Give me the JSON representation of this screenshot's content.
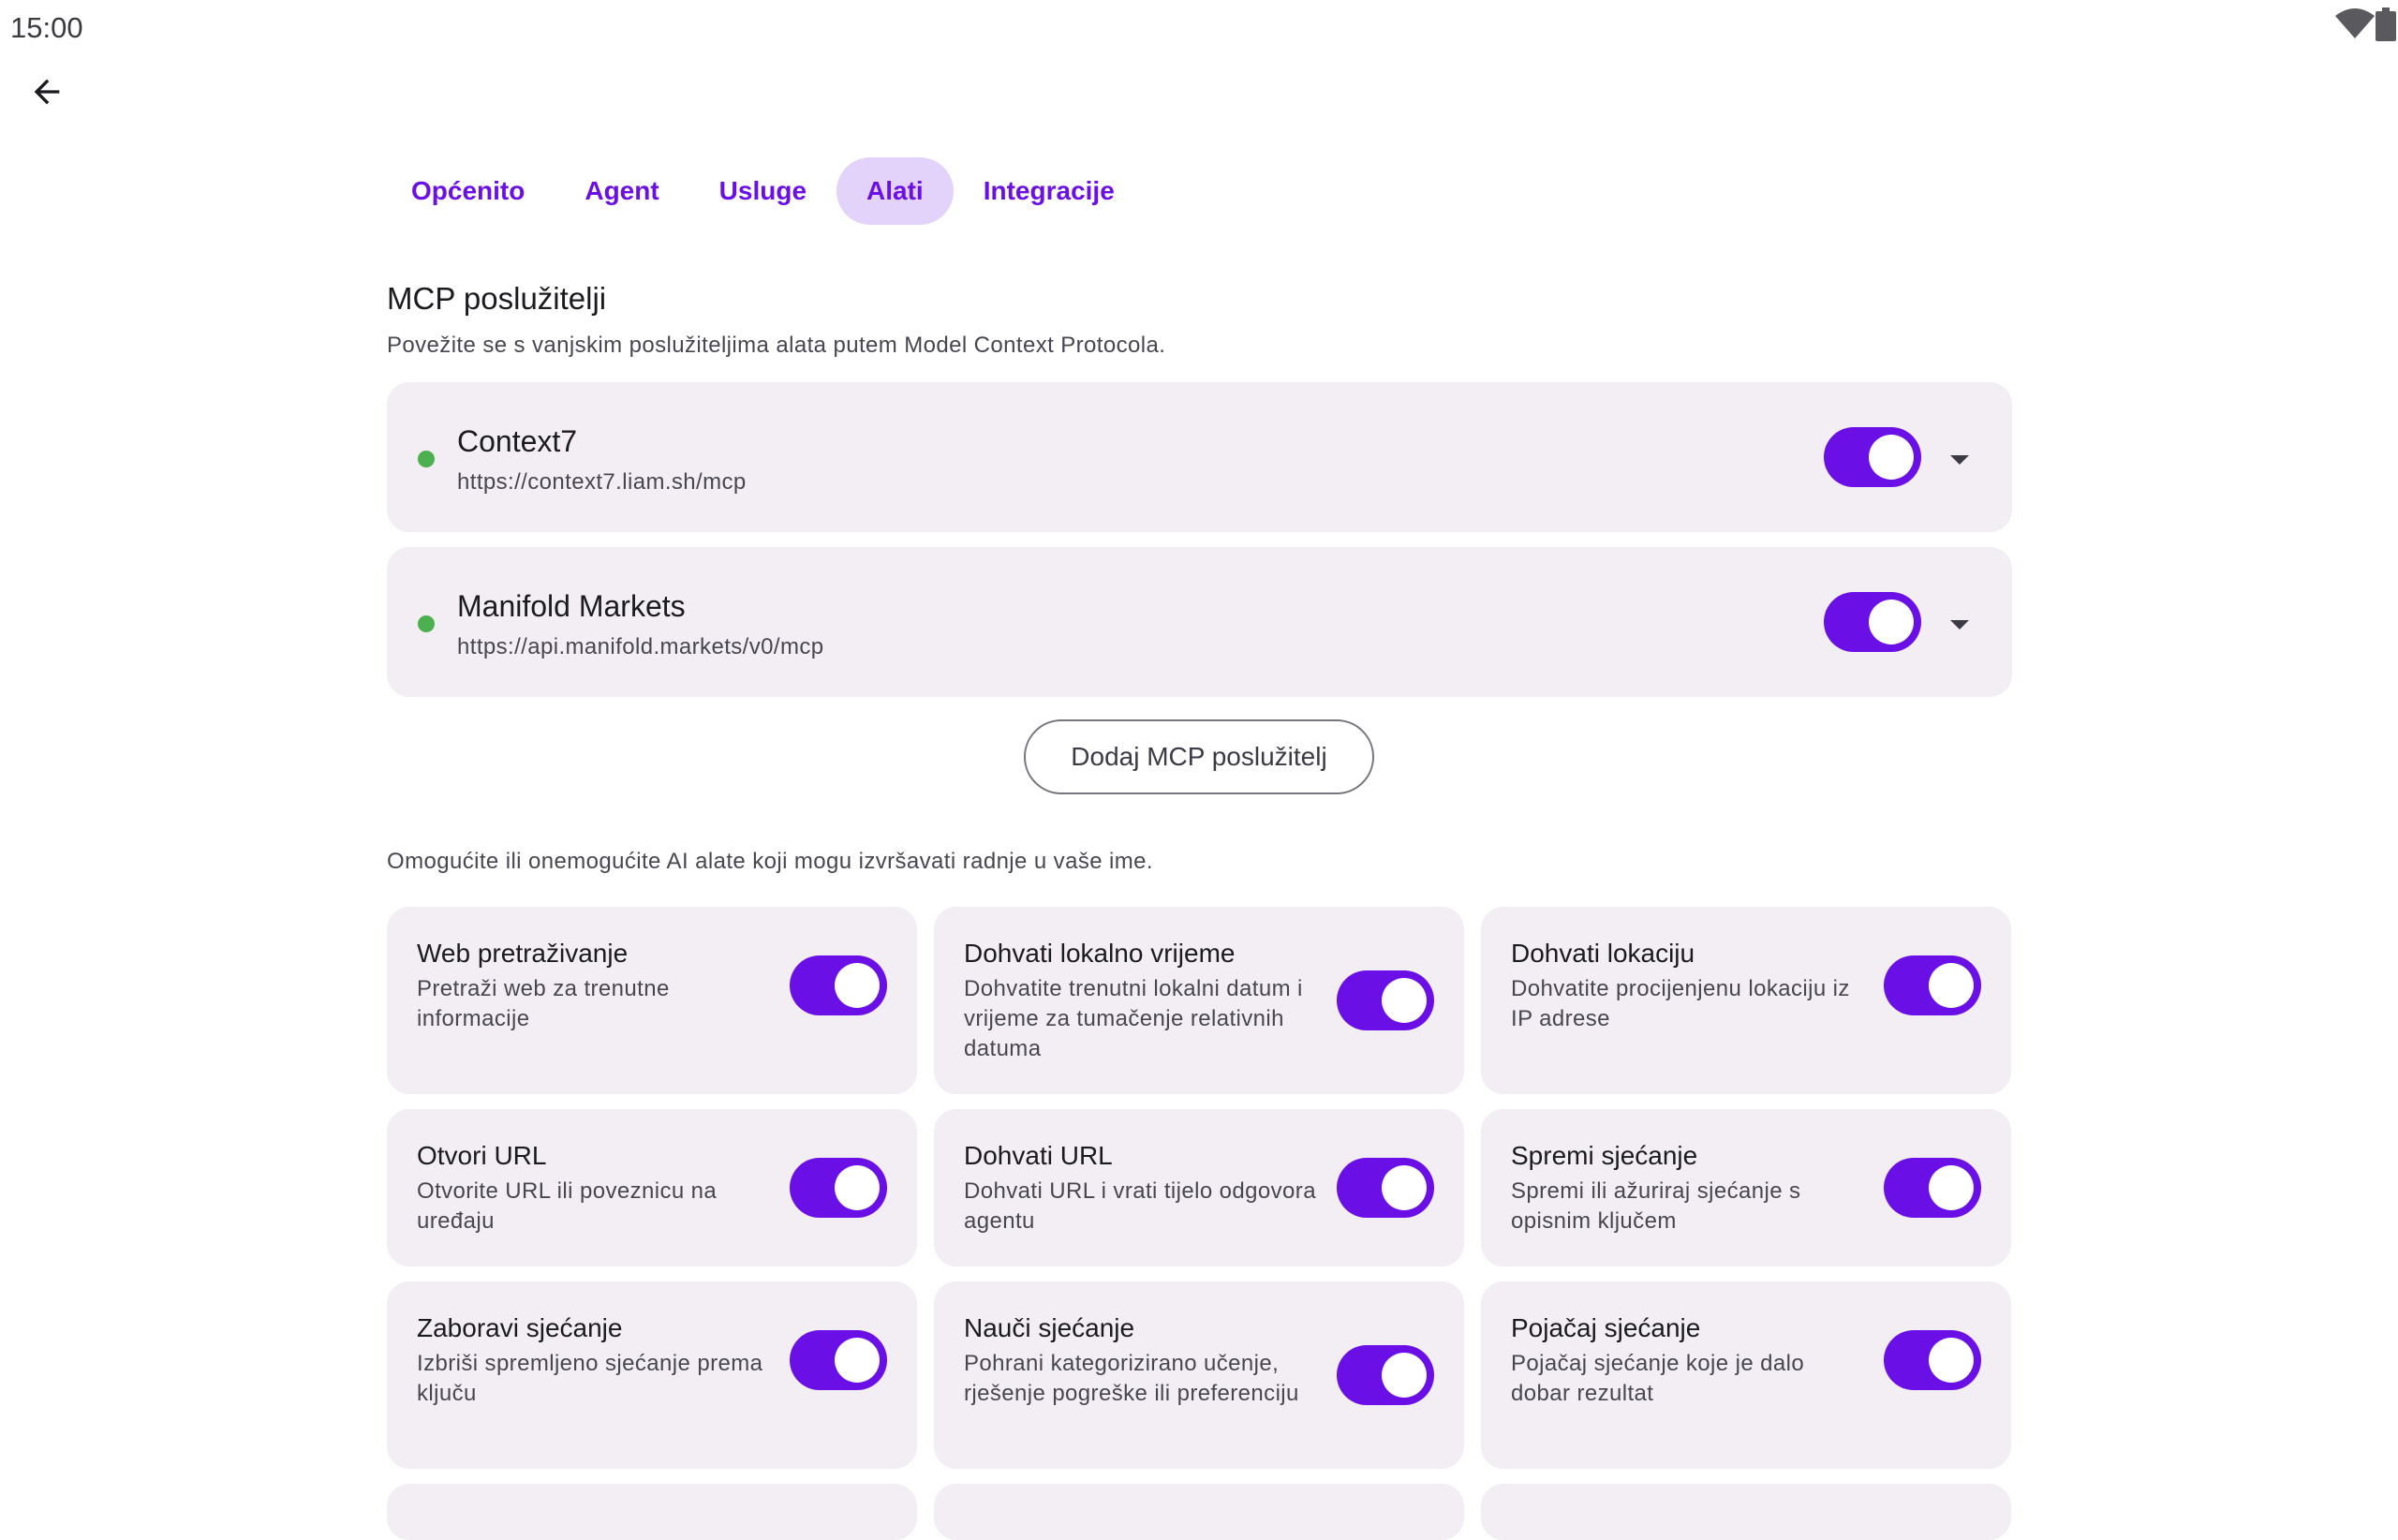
{
  "status_bar": {
    "time": "15:00",
    "wifi_icon": "wifi-icon",
    "battery_icon": "battery-icon"
  },
  "back_icon": "arrow-back-icon",
  "tabs": [
    {
      "label": "Općenito",
      "active": false
    },
    {
      "label": "Agent",
      "active": false
    },
    {
      "label": "Usluge",
      "active": false
    },
    {
      "label": "Alati",
      "active": true
    },
    {
      "label": "Integracije",
      "active": false
    }
  ],
  "mcp": {
    "title": "MCP poslužitelji",
    "description": "Povežite se s vanjskim poslužiteljima alata putem Model Context Protocola.",
    "servers": [
      {
        "name": "Context7",
        "url": "https://context7.liam.sh/mcp",
        "status": "connected",
        "enabled": true
      },
      {
        "name": "Manifold Markets",
        "url": "https://api.manifold.markets/v0/mcp",
        "status": "connected",
        "enabled": true
      }
    ],
    "add_button": "Dodaj MCP poslužitelj"
  },
  "tools": {
    "description": "Omogućite ili onemogućite AI alate koji mogu izvršavati radnje u vaše ime.",
    "items": [
      {
        "title": "Web pretraživanje",
        "description": "Pretraži web za trenutne informacije",
        "enabled": true
      },
      {
        "title": "Dohvati lokalno vrijeme",
        "description": "Dohvatite trenutni lokalni datum i vrijeme za tumačenje relativnih datuma",
        "enabled": true
      },
      {
        "title": "Dohvati lokaciju",
        "description": "Dohvatite procijenjenu lokaciju iz IP adrese",
        "enabled": true
      },
      {
        "title": "Otvori URL",
        "description": "Otvorite URL ili poveznicu na uređaju",
        "enabled": true
      },
      {
        "title": "Dohvati URL",
        "description": "Dohvati URL i vrati tijelo odgovora agentu",
        "enabled": true
      },
      {
        "title": "Spremi sjećanje",
        "description": "Spremi ili ažuriraj sjećanje s opisnim ključem",
        "enabled": true
      },
      {
        "title": "Zaboravi sjećanje",
        "description": "Izbriši spremljeno sjećanje prema ključu",
        "enabled": true
      },
      {
        "title": "Nauči sjećanje",
        "description": "Pohrani kategorizirano učenje, rješenje pogreške ili preferenciju",
        "enabled": true
      },
      {
        "title": "Pojačaj sjećanje",
        "description": "Pojačaj sjećanje koje je dalo dobar rezultat",
        "enabled": true
      }
    ]
  },
  "colors": {
    "accent": "#6a0fe6",
    "active_tab_bg": "#e3d3fb",
    "card_bg": "#f2eef4",
    "status_ok": "#4caf50"
  }
}
